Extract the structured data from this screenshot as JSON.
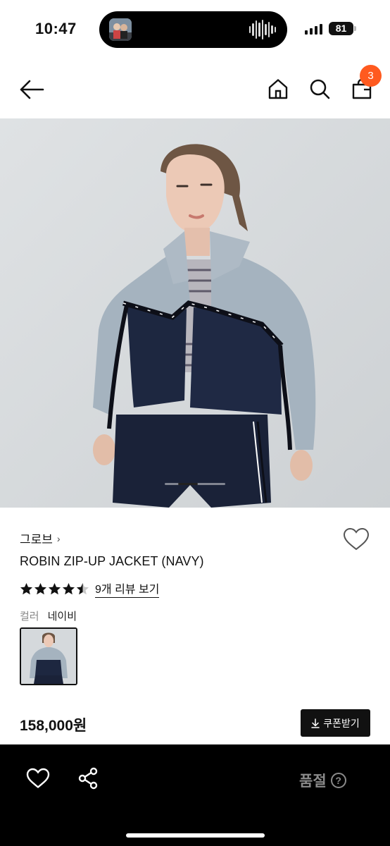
{
  "status_bar": {
    "time": "10:47",
    "battery": "81"
  },
  "nav": {
    "back_icon": "arrow-left-icon",
    "home_icon": "home-icon",
    "search_icon": "search-icon",
    "bag_icon": "shopping-bag-icon",
    "cart_count": "3"
  },
  "gallery": {
    "current_index": 1,
    "indicator_fraction": 0.33
  },
  "product": {
    "brand": "그로브",
    "brand_chevron": "›",
    "name": "ROBIN ZIP-UP JACKET (NAVY)",
    "rating": 4.5,
    "review_link": "9개 리뷰 보기",
    "option_label": "컬러",
    "option_value": "네이비",
    "price": "158,000원",
    "coupon_button": "쿠폰받기",
    "coupon_icon": "download-icon",
    "wishlist_icon": "heart-outline-icon"
  },
  "bottom_bar": {
    "heart_icon": "heart-outline-icon",
    "share_icon": "share-icon",
    "status_text": "품절",
    "help_icon": "question-icon",
    "help_glyph": "?"
  },
  "colors": {
    "badge": "#ff5a1f",
    "bottom_bar_bg": "#000000",
    "status_text": "#8a8a8a",
    "coupon_bg": "#111111"
  }
}
